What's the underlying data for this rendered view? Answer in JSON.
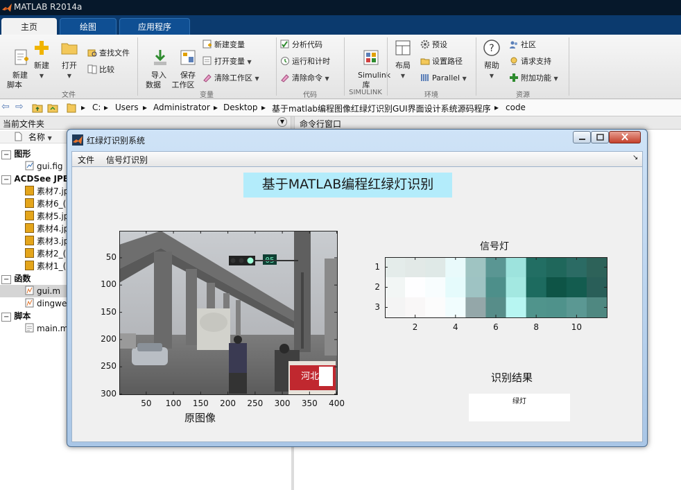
{
  "app": {
    "title": "MATLAB R2014a"
  },
  "tabs": [
    {
      "label": "主页"
    },
    {
      "label": "绘图"
    },
    {
      "label": "应用程序"
    }
  ],
  "ribbon": {
    "file": {
      "group_label": "文件",
      "new_script": "新建\n脚本",
      "new": "新建",
      "open": "打开",
      "find_files": "查找文件",
      "compare": "比较"
    },
    "variable": {
      "group_label": "变量",
      "import": "导入\n数据",
      "save_ws": "保存\n工作区",
      "new_var": "新建变量",
      "open_var": "打开变量",
      "clear_ws": "清除工作区"
    },
    "code": {
      "group_label": "代码",
      "analyze": "分析代码",
      "run_time": "运行和计时",
      "clear_cmd": "清除命令"
    },
    "simulink": {
      "group_label": "SIMULINK",
      "lib": "Simulink\n库"
    },
    "env": {
      "group_label": "环境",
      "layout": "布局",
      "prefs": "预设",
      "set_path": "设置路径",
      "parallel": "Parallel"
    },
    "resources": {
      "group_label": "资源",
      "help": "帮助",
      "community": "社区",
      "support": "请求支持",
      "addons": "附加功能"
    }
  },
  "address": {
    "crumbs": [
      "C:",
      "Users",
      "Administrator",
      "Desktop",
      "基于matlab编程图像红绿灯识别GUI界面设计系统源码程序",
      "code"
    ]
  },
  "panels": {
    "current_folder": "当前文件夹",
    "command_window": "命令行窗口",
    "name_col": "名称"
  },
  "files": {
    "groups": [
      {
        "label": "图形",
        "items": [
          "gui.fig"
        ]
      },
      {
        "label": "ACDSee JPEG",
        "items": [
          "素材7.jp",
          "素材6_(",
          "素材5.jp",
          "素材4.jp",
          "素材3.jp",
          "素材2_(",
          "素材1_("
        ]
      },
      {
        "label": "函数",
        "items": [
          "gui.m",
          "dingwe"
        ]
      },
      {
        "label": "脚本",
        "items": [
          "main.m"
        ]
      }
    ],
    "selected": "gui.m"
  },
  "figure": {
    "title": "红绿灯识别系统",
    "menu": [
      "文件",
      "信号灯识别"
    ],
    "gui_title": "基于MATLAB编程红绿灯识别",
    "image_axes": {
      "xlabel": "原图像",
      "xticks": [
        "50",
        "100",
        "150",
        "200",
        "250",
        "300",
        "350",
        "400"
      ],
      "yticks": [
        "50",
        "100",
        "150",
        "200",
        "250",
        "300"
      ],
      "watermark_text": "河北"
    },
    "signal_axes": {
      "title": "信号灯",
      "xticks": [
        "2",
        "4",
        "6",
        "8",
        "10"
      ],
      "yticks": [
        "1",
        "2",
        "3"
      ]
    },
    "result": {
      "label": "识别结果",
      "value": "绿灯"
    }
  }
}
